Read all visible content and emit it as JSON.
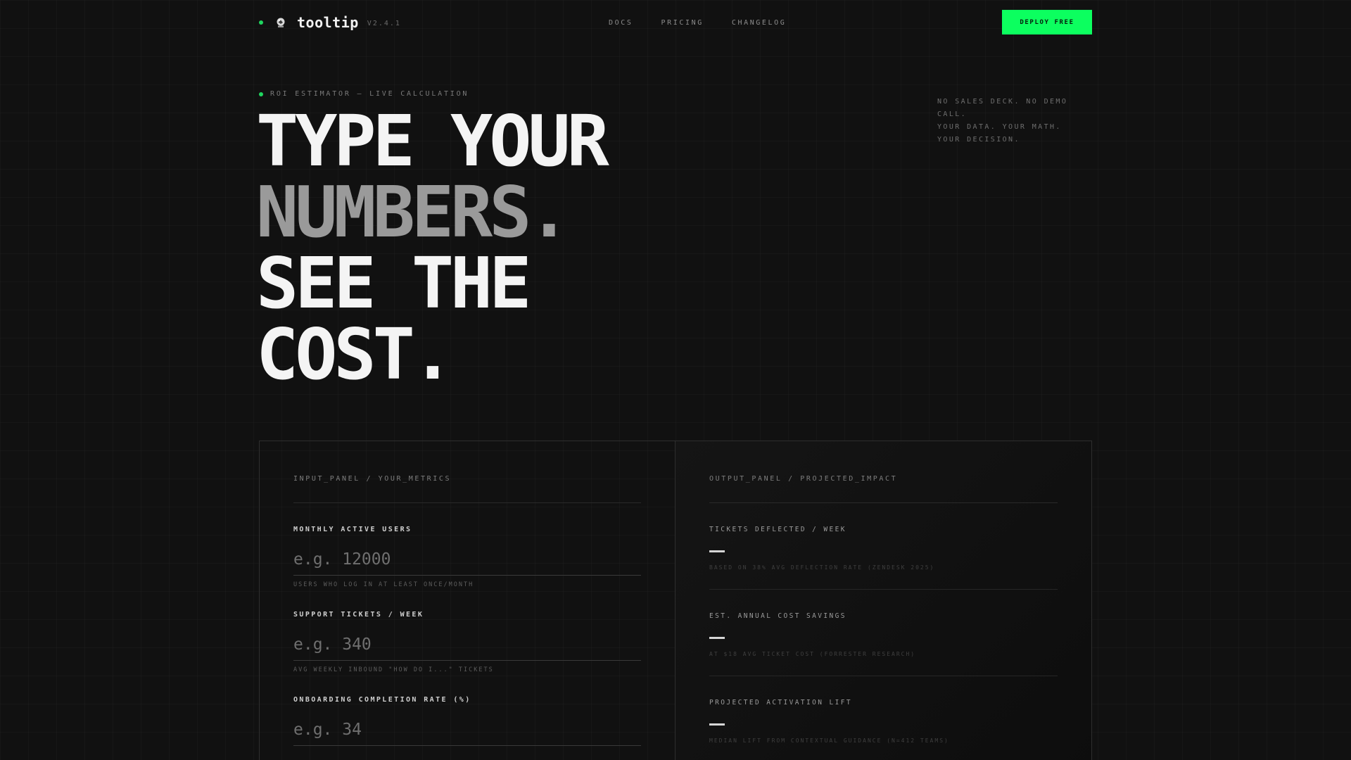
{
  "nav": {
    "brand": "tooltip",
    "version": "V2.4.1",
    "logo_icon": "crystal-ball-icon",
    "links": [
      "DOCS",
      "PRICING",
      "CHANGELOG"
    ],
    "cta_label": "DEPLOY FREE"
  },
  "hero": {
    "eyebrow": "ROI ESTIMATOR — LIVE CALCULATION",
    "headline": [
      "TYPE YOUR",
      "NUMBERS.",
      "SEE THE",
      "COST."
    ],
    "tagline": [
      "NO SALES DECK. NO DEMO",
      "CALL.",
      "YOUR DATA. YOUR MATH.",
      "YOUR DECISION."
    ]
  },
  "input_panel": {
    "title": "INPUT_PANEL / YOUR_METRICS",
    "fields": [
      {
        "label": "MONTHLY ACTIVE USERS",
        "value": "",
        "placeholder": "e.g. 12000",
        "hint": "USERS WHO LOG IN AT LEAST ONCE/MONTH"
      },
      {
        "label": "SUPPORT TICKETS / WEEK",
        "value": "",
        "placeholder": "e.g. 340",
        "hint": "AVG WEEKLY INBOUND \"HOW DO I...\" TICKETS"
      },
      {
        "label": "ONBOARDING COMPLETION RATE (%)",
        "value": "",
        "placeholder": "e.g. 34",
        "hint": ""
      }
    ]
  },
  "output_panel": {
    "title": "OUTPUT_PANEL / PROJECTED_IMPACT",
    "metrics": [
      {
        "label": "TICKETS DEFLECTED / WEEK",
        "value": "—",
        "note": "BASED ON 38% AVG DEFLECTION RATE (ZENDESK 2025)"
      },
      {
        "label": "EST. ANNUAL COST SAVINGS",
        "value": "—",
        "note": "AT $18 AVG TICKET COST (FORRESTER RESEARCH)"
      },
      {
        "label": "PROJECTED ACTIVATION LIFT",
        "value": "—",
        "note": "MEDIAN LIFT FROM CONTEXTUAL GUIDANCE (N=412 TEAMS)"
      }
    ]
  },
  "colors": {
    "accent": "#0cff5f",
    "status_dot": "#1fd65f",
    "background": "#111111"
  }
}
